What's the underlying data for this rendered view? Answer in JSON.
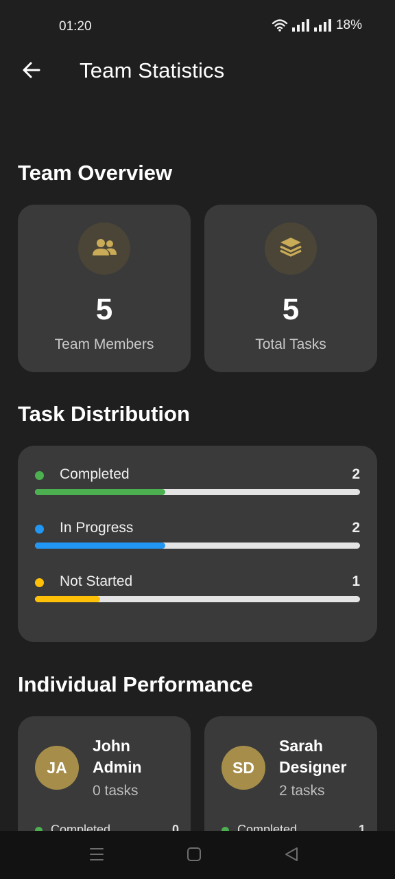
{
  "status_bar": {
    "time": "01:20",
    "battery": "18%",
    "icons": [
      "wifi-icon",
      "signal-icon",
      "signal-icon"
    ]
  },
  "app_bar": {
    "title": "Team Statistics",
    "back_icon": "arrow-left-icon"
  },
  "overview": {
    "title": "Team Overview",
    "cards": [
      {
        "icon": "people-icon",
        "value": "5",
        "label": "Team Members"
      },
      {
        "icon": "layers-icon",
        "value": "5",
        "label": "Total Tasks"
      }
    ]
  },
  "distribution": {
    "title": "Task Distribution",
    "rows": [
      {
        "label": "Completed",
        "count": "2",
        "fraction": 0.4,
        "color": "#4caf50"
      },
      {
        "label": "In Progress",
        "count": "2",
        "fraction": 0.4,
        "color": "#2196f3"
      },
      {
        "label": "Not Started",
        "count": "1",
        "fraction": 0.2,
        "color": "#ffc107"
      }
    ],
    "track_color": "#e4e4e4"
  },
  "performance": {
    "title": "Individual Performance",
    "members": [
      {
        "initials": "JA",
        "name": "John Admin",
        "tasks": "0 tasks",
        "stat_label": "Completed",
        "stat_count": "0"
      },
      {
        "initials": "SD",
        "name": "Sarah Designer",
        "tasks": "2 tasks",
        "stat_label": "Completed",
        "stat_count": "1"
      }
    ]
  },
  "colors": {
    "background": "#1f1f1f",
    "card": "#3a3a3a",
    "accent": "#a68e4a",
    "icon_circle": "#4a4536",
    "icon_color": "#c9ab58"
  },
  "nav_bar": {
    "icons": [
      "menu-icon",
      "home-square-icon",
      "back-triangle-icon"
    ]
  }
}
